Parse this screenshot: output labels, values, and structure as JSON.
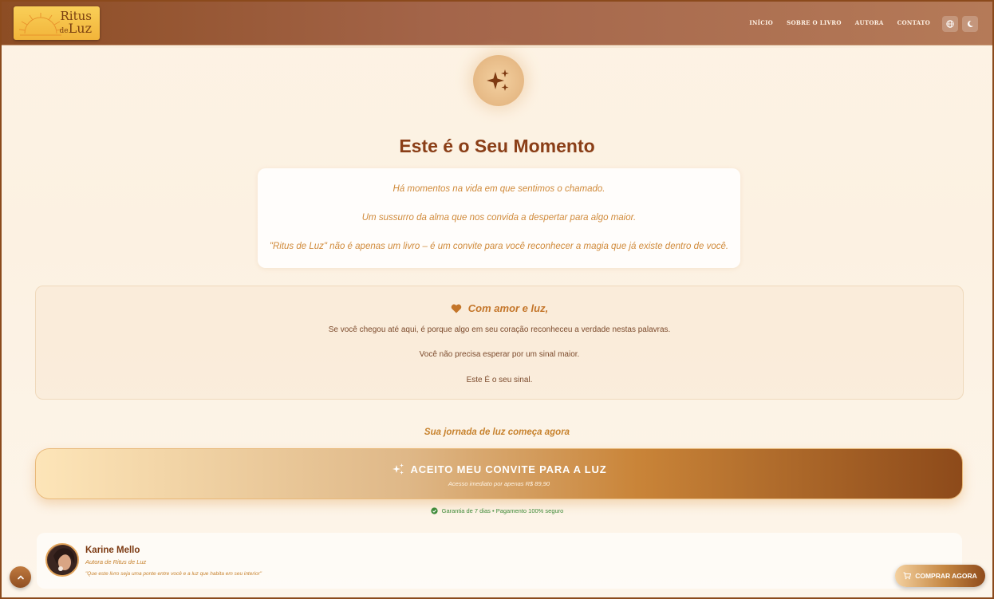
{
  "header": {
    "logo": {
      "line1": "Ritus",
      "de": "de",
      "line2": "Luz"
    },
    "nav": [
      {
        "label": "INÍCIO"
      },
      {
        "label": "SOBRE O LIVRO"
      },
      {
        "label": "AUTORA"
      },
      {
        "label": "CONTATO"
      }
    ],
    "icons": {
      "language": "globe-icon",
      "theme": "moon-icon"
    }
  },
  "hero": {
    "icon": "sparkles-icon",
    "title": "Este é o Seu Momento",
    "quotes": [
      "Há momentos na vida em que sentimos o chamado.",
      "Um sussurro da alma que nos convida a despertar para algo maior.",
      "\"Ritus de Luz\" não é apenas um livro – é um convite para você reconhecer a magia que já existe dentro de você."
    ]
  },
  "love": {
    "icon": "heart-icon",
    "title": "Com amor e luz,",
    "lines": [
      "Se você chegou até aqui, é porque algo em seu coração reconheceu a verdade nestas palavras.",
      "Você não precisa esperar por um sinal maior.",
      "Este É o seu sinal."
    ]
  },
  "cta": {
    "journey": "Sua jornada de luz começa agora",
    "button_label": "ACEITO MEU CONVITE PARA A LUZ",
    "button_sub": "Acesso imediato por apenas R$ 89,90",
    "guarantee": "Garantia de 7 dias • Pagamento 100% seguro"
  },
  "author": {
    "name": "Karine Mello",
    "role": "Autora de Ritus de Luz",
    "quote": "\"Que este livro seja uma ponte entre você e a luz que habita em seu interior\""
  },
  "floating": {
    "buy_label": "COMPRAR AGORA",
    "scroll_top": "chevron-up-icon"
  },
  "colors": {
    "brand_brown": "#8b4a1c",
    "accent_gold": "#c7822d",
    "guarantee_green": "#3f8b3a"
  }
}
